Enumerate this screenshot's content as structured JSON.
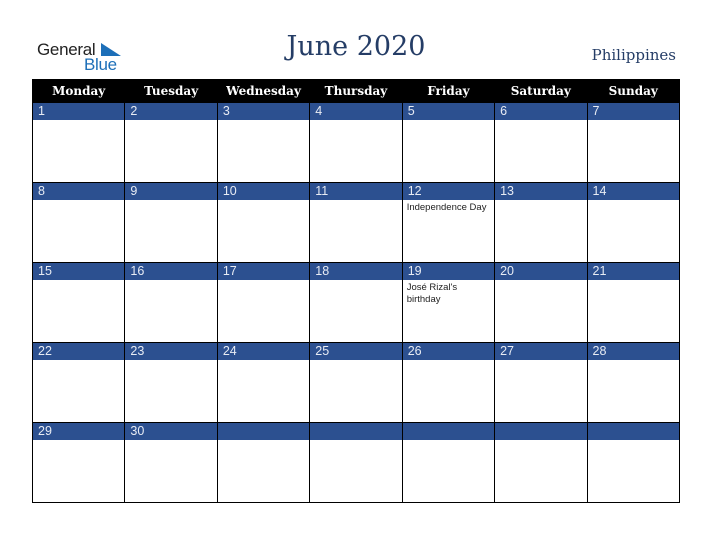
{
  "logo": {
    "word1": "General",
    "word2": "Blue",
    "icon": "triangle-flag-icon",
    "color": "#1d6fb8"
  },
  "header": {
    "title": "June 2020",
    "country": "Philippines"
  },
  "colors": {
    "header_bg": "#000000",
    "day_band": "#2c5090",
    "title": "#253d66"
  },
  "weekdays": [
    "Monday",
    "Tuesday",
    "Wednesday",
    "Thursday",
    "Friday",
    "Saturday",
    "Sunday"
  ],
  "weeks": [
    [
      {
        "day": "1",
        "event": ""
      },
      {
        "day": "2",
        "event": ""
      },
      {
        "day": "3",
        "event": ""
      },
      {
        "day": "4",
        "event": ""
      },
      {
        "day": "5",
        "event": ""
      },
      {
        "day": "6",
        "event": ""
      },
      {
        "day": "7",
        "event": ""
      }
    ],
    [
      {
        "day": "8",
        "event": ""
      },
      {
        "day": "9",
        "event": ""
      },
      {
        "day": "10",
        "event": ""
      },
      {
        "day": "11",
        "event": ""
      },
      {
        "day": "12",
        "event": "Independence Day"
      },
      {
        "day": "13",
        "event": ""
      },
      {
        "day": "14",
        "event": ""
      }
    ],
    [
      {
        "day": "15",
        "event": ""
      },
      {
        "day": "16",
        "event": ""
      },
      {
        "day": "17",
        "event": ""
      },
      {
        "day": "18",
        "event": ""
      },
      {
        "day": "19",
        "event": "José Rizal's birthday"
      },
      {
        "day": "20",
        "event": ""
      },
      {
        "day": "21",
        "event": ""
      }
    ],
    [
      {
        "day": "22",
        "event": ""
      },
      {
        "day": "23",
        "event": ""
      },
      {
        "day": "24",
        "event": ""
      },
      {
        "day": "25",
        "event": ""
      },
      {
        "day": "26",
        "event": ""
      },
      {
        "day": "27",
        "event": ""
      },
      {
        "day": "28",
        "event": ""
      }
    ],
    [
      {
        "day": "29",
        "event": ""
      },
      {
        "day": "30",
        "event": ""
      },
      {
        "day": "",
        "event": ""
      },
      {
        "day": "",
        "event": ""
      },
      {
        "day": "",
        "event": ""
      },
      {
        "day": "",
        "event": ""
      },
      {
        "day": "",
        "event": ""
      }
    ]
  ]
}
